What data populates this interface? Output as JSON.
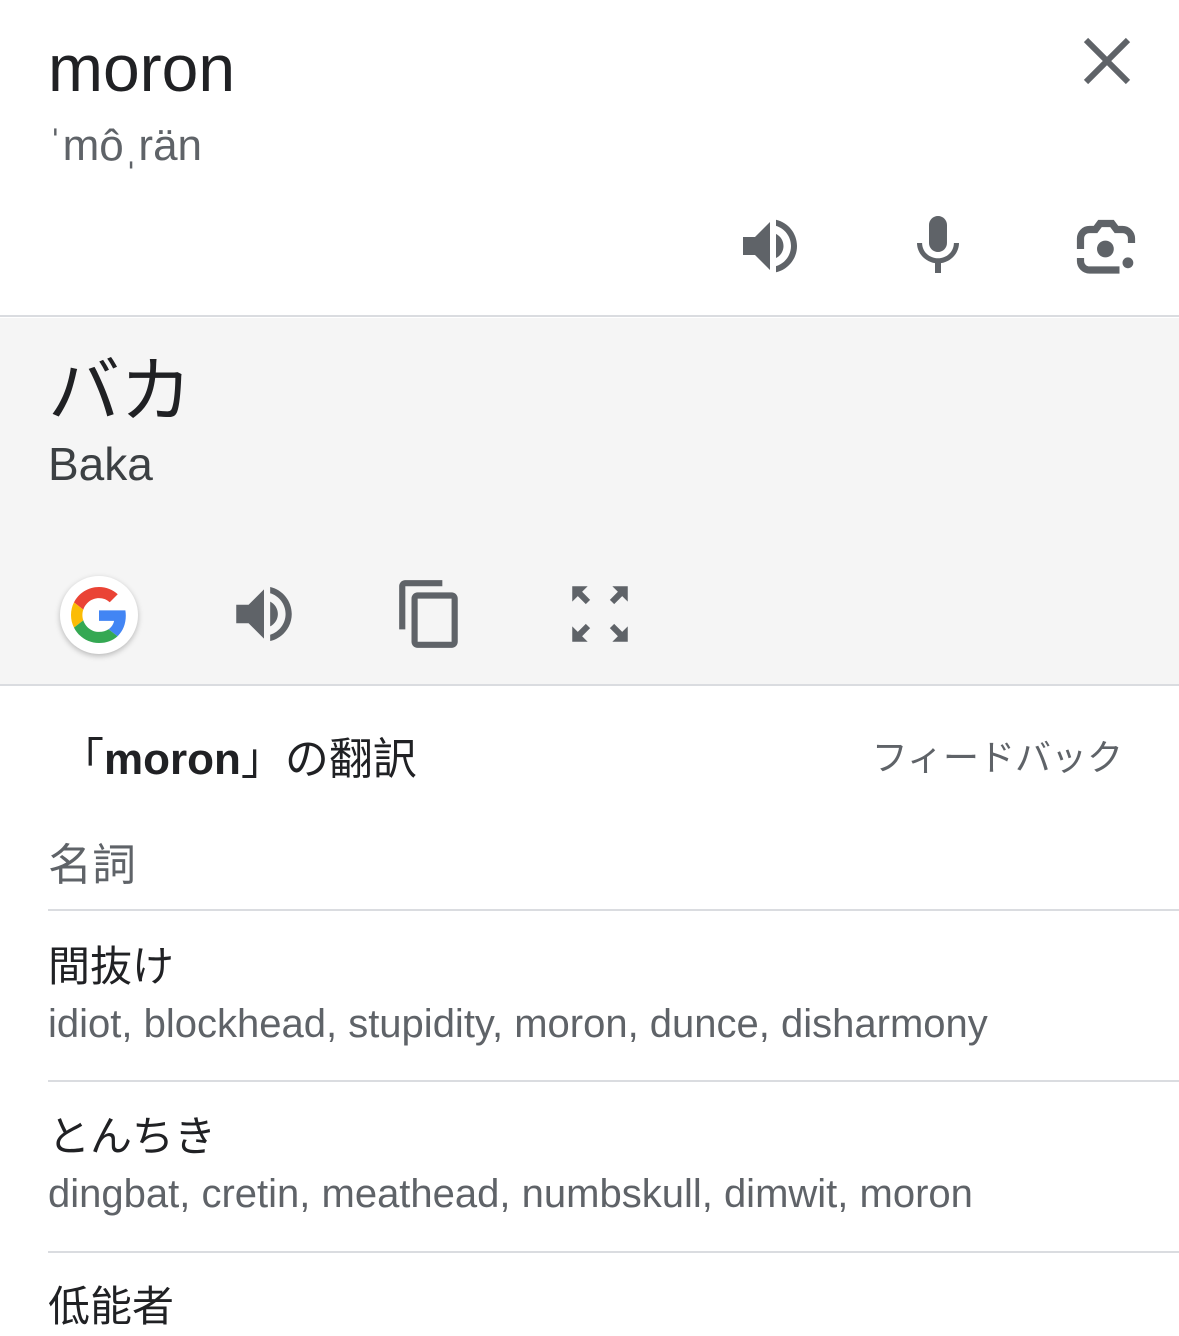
{
  "source": {
    "word": "moron",
    "phonetic": "ˈmôˌrän"
  },
  "target": {
    "word": "バカ",
    "transliteration": "Baka"
  },
  "dictionary": {
    "heading_open": "「",
    "heading_term": "moron",
    "heading_rest": "」の翻訳",
    "feedback_label": "フィードバック",
    "part_of_speech": "名詞",
    "entries": [
      {
        "term": "間抜け",
        "synonyms": "idiot, blockhead, stupidity, moron, dunce, disharmony"
      },
      {
        "term": "とんちき",
        "synonyms": "dingbat, cretin, meathead, numbskull, dimwit, moron"
      },
      {
        "term": "低能者",
        "synonyms": ""
      }
    ]
  },
  "colors": {
    "icon": "#5f6368",
    "text": "#202124",
    "panel_bg": "#f5f5f5",
    "divider": "#dadce0"
  }
}
